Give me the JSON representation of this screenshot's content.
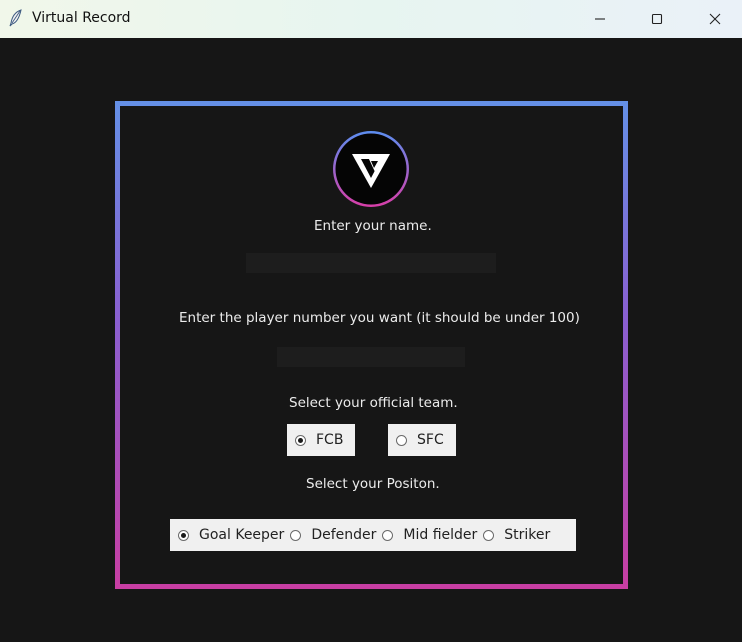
{
  "window": {
    "title": "Virtual Record"
  },
  "form": {
    "name_label": "Enter your name.",
    "name_value": "",
    "number_label": "Enter the player number you want (it should be under 100)",
    "number_value": "",
    "team_label": "Select your official team.",
    "teams": [
      {
        "label": "FCB",
        "selected": true
      },
      {
        "label": "SFC",
        "selected": false
      }
    ],
    "position_label": "Select your Positon.",
    "positions": [
      {
        "label": "Goal Keeper",
        "selected": true
      },
      {
        "label": "Defender",
        "selected": false
      },
      {
        "label": "Mid fielder",
        "selected": false
      },
      {
        "label": "Striker",
        "selected": false
      }
    ]
  },
  "colors": {
    "background": "#161616",
    "frame_top": "#6490e6",
    "frame_bottom": "#c83ea3",
    "radio_panel": "#f0f0f0",
    "entry": "#1d1d1d"
  },
  "icons": {
    "app": "feather-icon",
    "logo": "vs-logo",
    "minimize": "minimize-icon",
    "maximize": "maximize-icon",
    "close": "close-icon"
  }
}
